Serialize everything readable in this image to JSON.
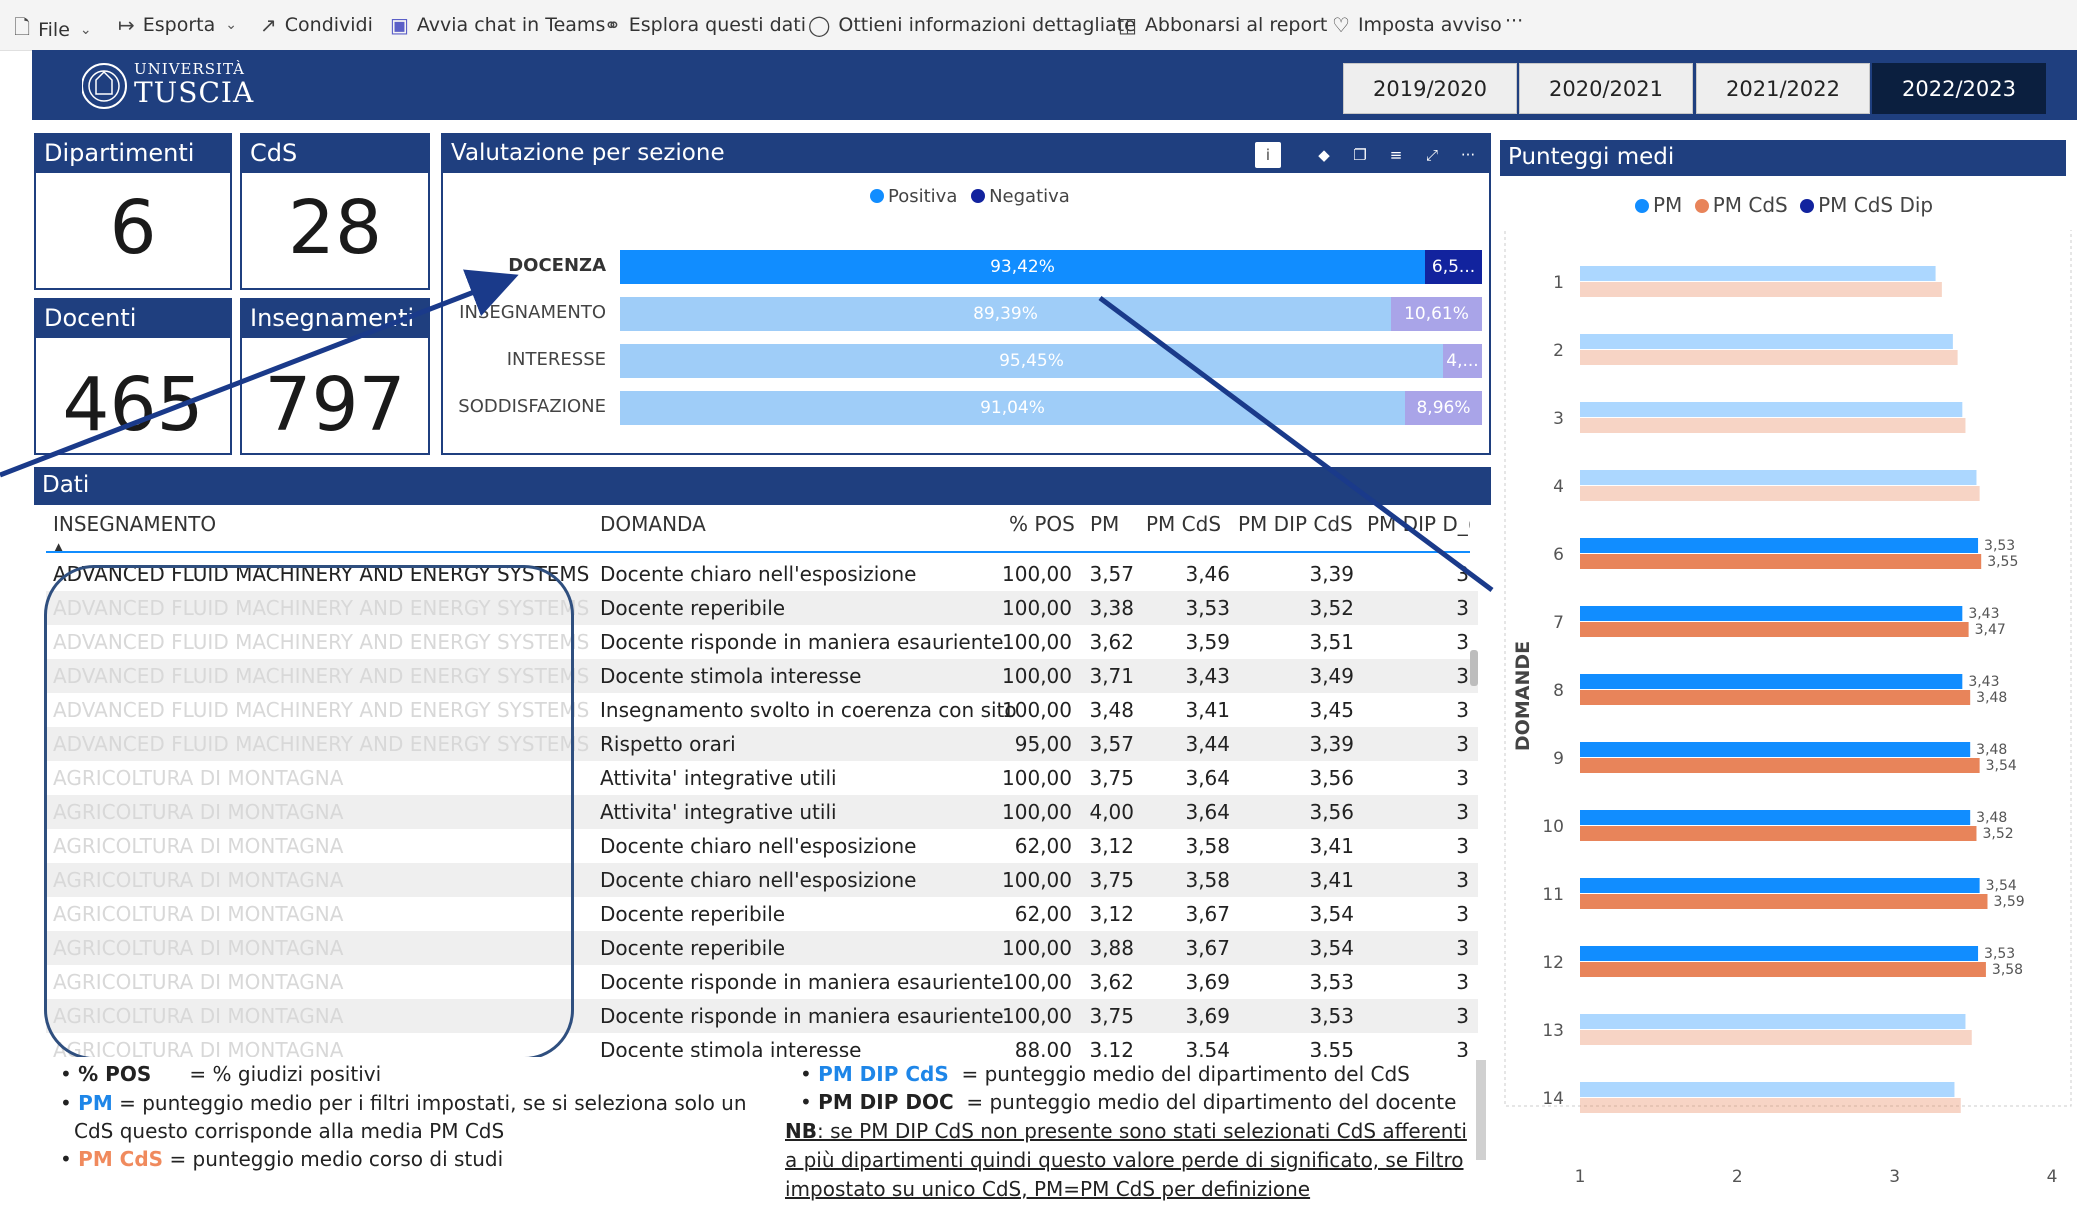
{
  "toolbar": {
    "file": "File",
    "export": "Esporta",
    "share": "Condividi",
    "teams": "Avvia chat in Teams",
    "explore": "Esplora questi dati",
    "insights": "Ottieni informazioni dettagliate",
    "subscribe": "Abbonarsi al report",
    "alert": "Imposta avviso",
    "more": "···"
  },
  "header": {
    "logo_line1": "UNIVERSITÀ",
    "logo_line2": "TUSCIA",
    "years": [
      "2019/2020",
      "2020/2021",
      "2021/2022",
      "2022/2023"
    ],
    "active_year": "2022/2023"
  },
  "kpis": {
    "dipartimenti": {
      "label": "Dipartimenti",
      "value": "6"
    },
    "cds": {
      "label": "CdS",
      "value": "28"
    },
    "docenti": {
      "label": "Docenti",
      "value": "465"
    },
    "insegnamenti": {
      "label": "Insegnamenti",
      "value": "797"
    }
  },
  "valutazione": {
    "title": "Valutazione per sezione",
    "legend": {
      "positive": "Positiva",
      "negative": "Negativa"
    },
    "colors": {
      "positive_strong": "#118dff",
      "negative_strong": "#12239e",
      "positive_light": "#9fcdf8",
      "negative_light": "#a9a4e8"
    },
    "rows": [
      {
        "label": "DOCENZA",
        "positive": 93.42,
        "positive_label": "93,42%",
        "negative_label": "6,5...",
        "highlight": true
      },
      {
        "label": "INSEGNAMENTO",
        "positive": 89.39,
        "positive_label": "89,39%",
        "negative_label": "10,61%",
        "highlight": false
      },
      {
        "label": "INTERESSE",
        "positive": 95.45,
        "positive_label": "95,45%",
        "negative_label": "4,...",
        "highlight": false
      },
      {
        "label": "SODDISFAZIONE",
        "positive": 91.04,
        "positive_label": "91,04%",
        "negative_label": "8,96%",
        "highlight": false
      }
    ]
  },
  "dati": {
    "title": "Dati",
    "columns": [
      "INSEGNAMENTO",
      "DOMANDA",
      "% POS",
      "PM",
      "PM CdS",
      "PM DIP CdS",
      "PM DIP D_("
    ],
    "rows": [
      [
        "ADVANCED FLUID MACHINERY AND ENERGY SYSTEMS",
        "Docente chiaro nell'esposizione",
        "100,00",
        "3,57",
        "3,46",
        "3,39",
        "3"
      ],
      [
        "ADVANCED FLUID MACHINERY AND ENERGY SYSTEMS",
        "Docente reperibile",
        "100,00",
        "3,38",
        "3,53",
        "3,52",
        "3"
      ],
      [
        "ADVANCED FLUID MACHINERY AND ENERGY SYSTEMS",
        "Docente risponde in maniera esauriente",
        "100,00",
        "3,62",
        "3,59",
        "3,51",
        "3"
      ],
      [
        "ADVANCED FLUID MACHINERY AND ENERGY SYSTEMS",
        "Docente stimola interesse",
        "100,00",
        "3,71",
        "3,43",
        "3,49",
        "3"
      ],
      [
        "ADVANCED FLUID MACHINERY AND ENERGY SYSTEMS",
        "Insegnamento svolto in coerenza con sito",
        "100,00",
        "3,48",
        "3,41",
        "3,45",
        "3"
      ],
      [
        "ADVANCED FLUID MACHINERY AND ENERGY SYSTEMS",
        "Rispetto orari",
        "95,00",
        "3,57",
        "3,44",
        "3,39",
        "3"
      ],
      [
        "AGRICOLTURA DI MONTAGNA",
        "Attivita' integrative utili",
        "100,00",
        "3,75",
        "3,64",
        "3,56",
        "3"
      ],
      [
        "AGRICOLTURA DI MONTAGNA",
        "Attivita' integrative utili",
        "100,00",
        "4,00",
        "3,64",
        "3,56",
        "3"
      ],
      [
        "AGRICOLTURA DI MONTAGNA",
        "Docente chiaro nell'esposizione",
        "62,00",
        "3,12",
        "3,58",
        "3,41",
        "3"
      ],
      [
        "AGRICOLTURA DI MONTAGNA",
        "Docente chiaro nell'esposizione",
        "100,00",
        "3,75",
        "3,58",
        "3,41",
        "3"
      ],
      [
        "AGRICOLTURA DI MONTAGNA",
        "Docente reperibile",
        "62,00",
        "3,12",
        "3,67",
        "3,54",
        "3"
      ],
      [
        "AGRICOLTURA DI MONTAGNA",
        "Docente reperibile",
        "100,00",
        "3,88",
        "3,67",
        "3,54",
        "3"
      ],
      [
        "AGRICOLTURA DI MONTAGNA",
        "Docente risponde in maniera esauriente",
        "100,00",
        "3,62",
        "3,69",
        "3,53",
        "3"
      ],
      [
        "AGRICOLTURA DI MONTAGNA",
        "Docente risponde in maniera esauriente",
        "100,00",
        "3,75",
        "3,69",
        "3,53",
        "3"
      ],
      [
        "AGRICOLTURA DI MONTAGNA",
        "Docente stimola interesse",
        "88.00",
        "3.12",
        "3.54",
        "3.55",
        "3"
      ]
    ]
  },
  "notes": {
    "pos_key": "% POS",
    "pos_desc": "= % giudizi positivi",
    "pm_key": "PM",
    "pm_desc1": "= punteggio medio per i filtri impostati, se si  seleziona solo un",
    "pm_desc2": "CdS  questo corrisponde alla media PM CdS",
    "pmcds_key": "PM CdS",
    "pmcds_desc": "= punteggio medio corso di studi",
    "pmdipcds_key": "PM DIP CdS",
    "pmdipcds_desc": "= punteggio medio del dipartimento del CdS",
    "pmdipdoc_key": "PM DIP DOC",
    "pmdipdoc_desc": "= punteggio medio del dipartimento del docente",
    "nb_key": "NB",
    "nb_line1": ": se PM DIP CdS non presente sono stati selezionati CdS afferenti",
    "nb_line2": "a più dipartimenti quindi questo valore perde di significato, se Filtro",
    "nb_line3": "impostato su unico CdS, PM=PM CdS per definizione"
  },
  "punteggi": {
    "title": "Punteggi medi",
    "legend": [
      "PM",
      "PM CdS",
      "PM CdS Dip"
    ],
    "colors": {
      "pm": "#118dff",
      "pm_cds": "#e8845a",
      "pm_cds_dip": "#12239e"
    },
    "axis_title": "DOMANDE"
  },
  "chart_data": {
    "type": "bar",
    "orientation": "horizontal",
    "title": "Punteggi medi",
    "ylabel": "DOMANDE",
    "xlim": [
      1,
      4
    ],
    "xticks": [
      "1",
      "2",
      "3",
      "4"
    ],
    "categories": [
      "1",
      "2",
      "3",
      "4",
      "6",
      "7",
      "8",
      "9",
      "10",
      "11",
      "12",
      "13",
      "14"
    ],
    "highlighted": [
      false,
      false,
      false,
      false,
      true,
      true,
      true,
      true,
      true,
      true,
      true,
      false,
      false
    ],
    "series": [
      {
        "name": "PM",
        "values": [
          3.26,
          3.37,
          3.43,
          3.52,
          3.53,
          3.43,
          3.43,
          3.48,
          3.48,
          3.54,
          3.53,
          3.45,
          3.38
        ]
      },
      {
        "name": "PM CdS",
        "values": [
          3.3,
          3.4,
          3.45,
          3.54,
          3.55,
          3.47,
          3.48,
          3.54,
          3.52,
          3.59,
          3.58,
          3.49,
          3.42
        ]
      }
    ],
    "data_labels": [
      {
        "category": "6",
        "pm": "3,53",
        "pm_cds": "3,55"
      },
      {
        "category": "7",
        "pm": "3,43",
        "pm_cds": "3,47"
      },
      {
        "category": "8",
        "pm": "3,43",
        "pm_cds": "3,48"
      },
      {
        "category": "9",
        "pm": "3,48",
        "pm_cds": "3,54"
      },
      {
        "category": "10",
        "pm": "3,48",
        "pm_cds": "3,52"
      },
      {
        "category": "11",
        "pm": "3,54",
        "pm_cds": "3,59"
      },
      {
        "category": "12",
        "pm": "3,53",
        "pm_cds": "3,58"
      }
    ]
  }
}
